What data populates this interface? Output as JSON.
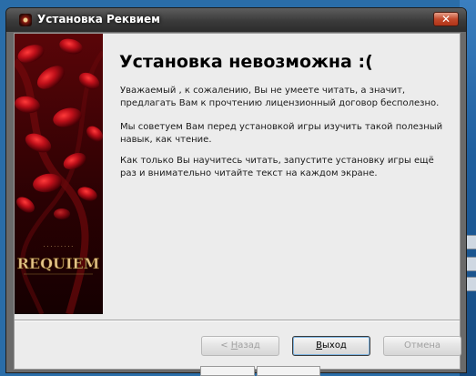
{
  "window": {
    "title": "Установка Реквием",
    "close_glyph": "✕"
  },
  "side_image": {
    "logo_text": "REQUIEM",
    "accent_color": "#c0101a"
  },
  "content": {
    "heading": "Установка невозможна :(",
    "paragraphs": [
      "Уважаемый , к сожалению, Вы не умеете читать, а значит, предлагать Вам к прочтению лицензионный договор бесполезно.",
      "Мы советуем Вам перед установкой игры изучить такой полезный навык, как чтение.",
      "Как только Вы научитесь читать, запустите установку игры ещё раз и внимательно читайте текст на каждом экране."
    ]
  },
  "buttons": {
    "back": {
      "prefix": "< ",
      "mnemonic": "Н",
      "rest": "азад",
      "enabled": false
    },
    "exit": {
      "mnemonic": "В",
      "rest": "ыход",
      "enabled": true
    },
    "cancel": {
      "label": "Отмена",
      "enabled": false
    }
  }
}
